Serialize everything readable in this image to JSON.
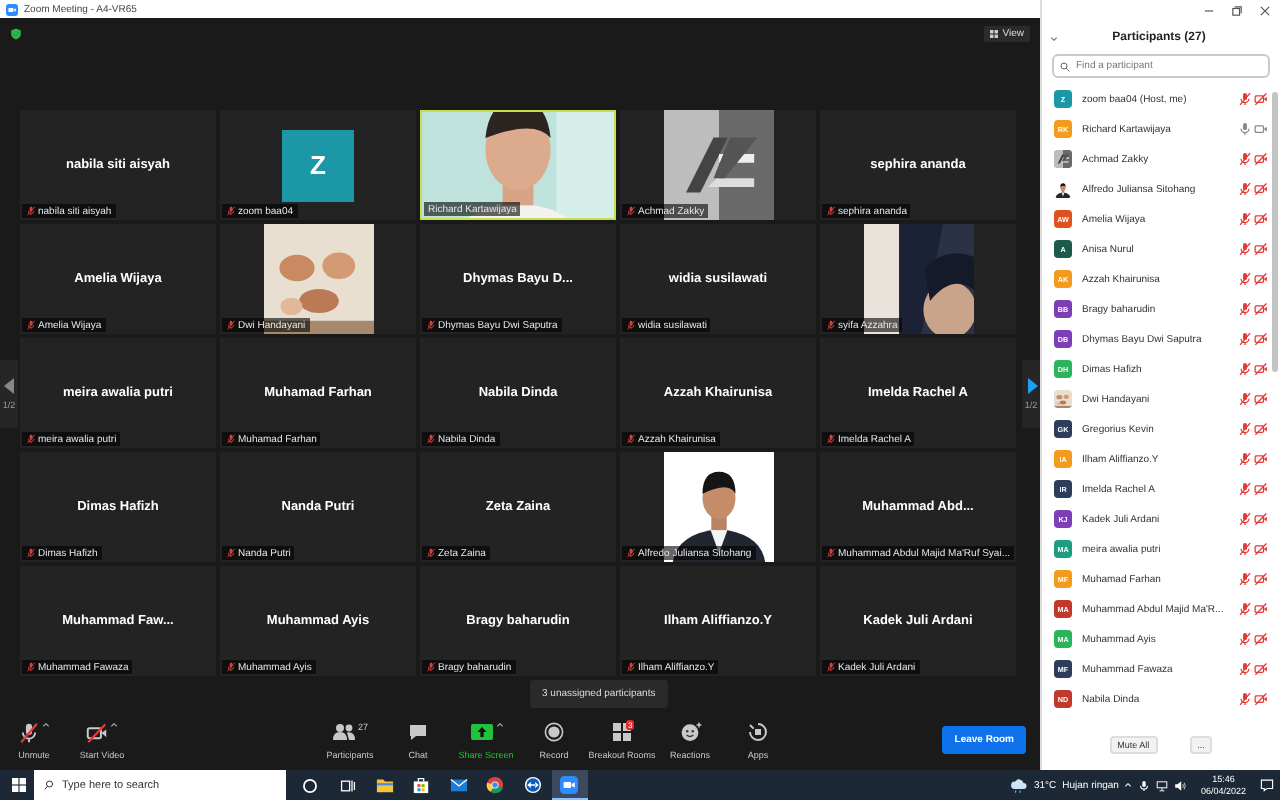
{
  "window": {
    "title": "Zoom Meeting - A4-VR65"
  },
  "top_bar": {
    "view_button": "View"
  },
  "grid": {
    "tiles": [
      {
        "kind": "name",
        "display_name": "nabila siti aisyah",
        "label": "nabila siti aisyah",
        "muted": true
      },
      {
        "kind": "avatar",
        "initial": "Z",
        "color": "#1b97a6",
        "label": "zoom baa04",
        "muted": true
      },
      {
        "kind": "video",
        "label": "Richard Kartawijaya",
        "muted": false
      },
      {
        "kind": "picture",
        "label": "Achmad Zakky",
        "muted": true
      },
      {
        "kind": "name",
        "display_name": "sephira ananda",
        "label": "sephira ananda",
        "muted": true
      },
      {
        "kind": "name",
        "display_name": "Amelia Wijaya",
        "label": "Amelia Wijaya",
        "muted": true
      },
      {
        "kind": "picture",
        "label": "Dwi Handayani",
        "muted": true
      },
      {
        "kind": "name",
        "display_name": "Dhymas Bayu D...",
        "label": "Dhymas Bayu Dwi Saputra",
        "muted": true
      },
      {
        "kind": "name",
        "display_name": "widia susilawati",
        "label": "widia susilawati",
        "muted": true
      },
      {
        "kind": "picture",
        "label": "syifa Azzahra",
        "muted": true
      },
      {
        "kind": "name",
        "display_name": "meira awalia putri",
        "label": "meira awalia putri",
        "muted": true
      },
      {
        "kind": "name",
        "display_name": "Muhamad Farhan",
        "label": "Muhamad Farhan",
        "muted": true
      },
      {
        "kind": "name",
        "display_name": "Nabila Dinda",
        "label": "Nabila Dinda",
        "muted": true
      },
      {
        "kind": "name",
        "display_name": "Azzah Khairunisa",
        "label": "Azzah Khairunisa",
        "muted": true
      },
      {
        "kind": "name",
        "display_name": "Imelda Rachel A",
        "label": "Imelda Rachel A",
        "muted": true
      },
      {
        "kind": "name",
        "display_name": "Dimas Hafizh",
        "label": "Dimas Hafizh",
        "muted": true
      },
      {
        "kind": "name",
        "display_name": "Nanda Putri",
        "label": "Nanda Putri",
        "muted": true
      },
      {
        "kind": "name",
        "display_name": "Zeta Zaina",
        "label": "Zeta Zaina",
        "muted": true
      },
      {
        "kind": "picture",
        "label": "Alfredo Juliansa Sitohang",
        "muted": true
      },
      {
        "kind": "name",
        "display_name": "Muhammad Abd...",
        "label": "Muhammad Abdul Majid Ma'Ruf Syai...",
        "muted": true
      },
      {
        "kind": "name",
        "display_name": "Muhammad Faw...",
        "label": "Muhammad Fawaza",
        "muted": true
      },
      {
        "kind": "name",
        "display_name": "Muhammad Ayis",
        "label": "Muhammad Ayis",
        "muted": true
      },
      {
        "kind": "name",
        "display_name": "Bragy baharudin",
        "label": "Bragy baharudin",
        "muted": true
      },
      {
        "kind": "name",
        "display_name": "Ilham Aliffianzo.Y",
        "label": "Ilham Aliffianzo.Y",
        "muted": true
      },
      {
        "kind": "name",
        "display_name": "Kadek Juli Ardani",
        "label": "Kadek Juli Ardani",
        "muted": true
      }
    ]
  },
  "pager": {
    "previous": "1/2",
    "next": "1/2"
  },
  "tooltip": "3 unassigned participants",
  "toolbar": {
    "items": [
      {
        "kind": "unmute",
        "label": "Unmute"
      },
      {
        "kind": "start_video",
        "label": "Start Video"
      },
      {
        "kind": "participants",
        "label": "Participants",
        "count": "27"
      },
      {
        "kind": "chat",
        "label": "Chat"
      },
      {
        "kind": "share_screen",
        "label": "Share Screen"
      },
      {
        "kind": "record",
        "label": "Record"
      },
      {
        "kind": "breakout_rooms",
        "label": "Breakout Rooms",
        "badge": "3"
      },
      {
        "kind": "reactions",
        "label": "Reactions"
      },
      {
        "kind": "apps",
        "label": "Apps"
      }
    ],
    "leave_button": "Leave Room"
  },
  "participants_panel": {
    "title": "Participants (27)",
    "search": {
      "placeholder": "Find a participant"
    },
    "participants": [
      {
        "kind": "initials",
        "initials": "Z",
        "color": "#1b97a6",
        "name": "zoom baa04 (Host, me)",
        "muted": true,
        "video_off": true
      },
      {
        "kind": "initials",
        "initials": "RK",
        "color": "#f29b1d",
        "name": "Richard Kartawijaya",
        "muted": false,
        "video_off": false
      },
      {
        "kind": "picture",
        "name": "Achmad Zakky",
        "muted": true,
        "video_off": true
      },
      {
        "kind": "picture",
        "name": "Alfredo Juliansa Sitohang",
        "muted": true,
        "video_off": true
      },
      {
        "kind": "initials",
        "initials": "AW",
        "color": "#e0521c",
        "name": "Amelia Wijaya",
        "muted": true,
        "video_off": true
      },
      {
        "kind": "initials",
        "initials": "A",
        "color": "#1d5a48",
        "name": "Anisa Nurul",
        "muted": true,
        "video_off": true
      },
      {
        "kind": "initials",
        "initials": "AK",
        "color": "#f29b1d",
        "name": "Azzah Khairunisa",
        "muted": true,
        "video_off": true
      },
      {
        "kind": "initials",
        "initials": "BB",
        "color": "#7d3fb8",
        "name": "Bragy baharudin",
        "muted": true,
        "video_off": true
      },
      {
        "kind": "initials",
        "initials": "DB",
        "color": "#7d3fb8",
        "name": "Dhymas Bayu Dwi Saputra",
        "muted": true,
        "video_off": true
      },
      {
        "kind": "initials",
        "initials": "DH",
        "color": "#2db35c",
        "name": "Dimas Hafizh",
        "muted": true,
        "video_off": true
      },
      {
        "kind": "picture",
        "name": "Dwi Handayani",
        "muted": true,
        "video_off": true
      },
      {
        "kind": "initials",
        "initials": "GK",
        "color": "#2c3e5c",
        "name": "Gregorius Kevin",
        "muted": true,
        "video_off": true
      },
      {
        "kind": "initials",
        "initials": "IA",
        "color": "#f29b1d",
        "name": "Ilham Aliffianzo.Y",
        "muted": true,
        "video_off": true
      },
      {
        "kind": "initials",
        "initials": "IR",
        "color": "#2c3e5c",
        "name": "Imelda Rachel A",
        "muted": true,
        "video_off": true
      },
      {
        "kind": "initials",
        "initials": "KJ",
        "color": "#7d3fb8",
        "name": "Kadek Juli Ardani",
        "muted": true,
        "video_off": true
      },
      {
        "kind": "initials",
        "initials": "MA",
        "color": "#1e9e80",
        "name": "meira awalia putri",
        "muted": true,
        "video_off": true
      },
      {
        "kind": "initials",
        "initials": "MF",
        "color": "#f29b1d",
        "name": "Muhamad Farhan",
        "muted": true,
        "video_off": true
      },
      {
        "kind": "initials",
        "initials": "MA",
        "color": "#c0392b",
        "name": "Muhammad Abdul Majid Ma'R...",
        "muted": true,
        "video_off": true
      },
      {
        "kind": "initials",
        "initials": "MA",
        "color": "#2db35c",
        "name": "Muhammad Ayis",
        "muted": true,
        "video_off": true
      },
      {
        "kind": "initials",
        "initials": "MF",
        "color": "#2c3e5c",
        "name": "Muhammad Fawaza",
        "muted": true,
        "video_off": true
      },
      {
        "kind": "initials",
        "initials": "ND",
        "color": "#c0392b",
        "name": "Nabila Dinda",
        "muted": true,
        "video_off": true
      }
    ],
    "buttons": [
      "Mute All",
      "..."
    ]
  },
  "taskbar": {
    "search": {
      "placeholder": "Type here to search"
    },
    "apps": [
      {
        "kind": "cortana",
        "active": false
      },
      {
        "kind": "task_view",
        "active": false
      },
      {
        "kind": "file_explorer",
        "active": false
      },
      {
        "kind": "store",
        "active": false
      },
      {
        "kind": "mail",
        "active": false
      },
      {
        "kind": "chrome",
        "active": false
      },
      {
        "kind": "teamviewer",
        "active": false
      },
      {
        "kind": "zoom",
        "active": true
      }
    ],
    "temperature": "31°C",
    "weather": "Hujan ringan",
    "time": "15:46",
    "date": "06/04/2022"
  }
}
